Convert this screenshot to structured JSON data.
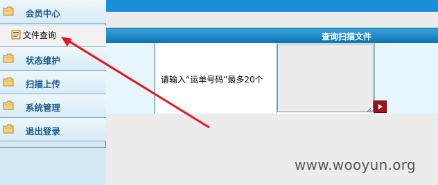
{
  "sidebar": {
    "items": [
      {
        "label": "会员中心",
        "icon": "folder-icon"
      },
      {
        "label": "文件查询",
        "icon": "document-icon",
        "selected": true
      },
      {
        "label": "状态维护",
        "icon": "folder-icon"
      },
      {
        "label": "扫描上传",
        "icon": "folder-icon"
      },
      {
        "label": "系统管理",
        "icon": "folder-icon"
      },
      {
        "label": "退出登录",
        "icon": "folder-icon"
      }
    ]
  },
  "main": {
    "table_title": "查询扫描文件",
    "prompt": "请输入“运单号码”最多20个",
    "waybill_input": {
      "value": "",
      "placeholder": ""
    },
    "submit_icon": "play-arrow-icon"
  },
  "watermark": "www.wooyun.org",
  "annotation": {
    "icon": "red-arrow-annotation",
    "color": "#e8141c"
  },
  "colors": {
    "top_band": "#1a8fd9",
    "header": "#0c73b6",
    "menu_text": "#1c5c88",
    "submit": "#a1101a"
  }
}
